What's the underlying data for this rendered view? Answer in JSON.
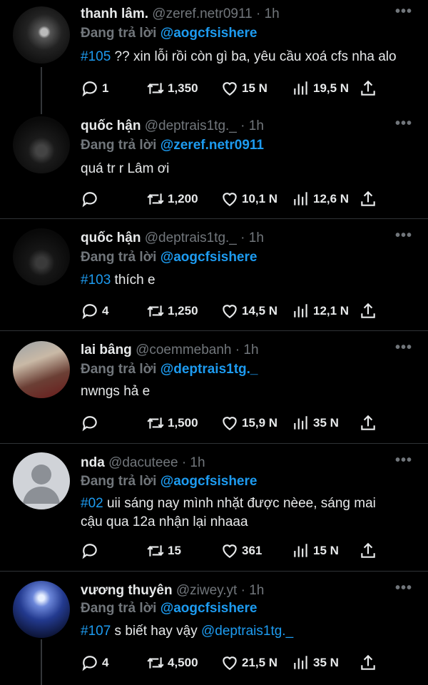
{
  "reply_prefix": "Đang trả lời",
  "colors": {
    "background": "#000000",
    "accent": "#1d9bf0",
    "muted": "#71767b",
    "text": "#e7e9ea"
  },
  "icons": [
    "reply-icon",
    "retweet-icon",
    "like-icon",
    "views-icon",
    "share-icon",
    "more-icon"
  ],
  "tweets": [
    {
      "name": "thanh lâm.",
      "handle": "@zeref.netr0911",
      "time": "· 1h",
      "reply_to": "@aogcfsishere",
      "tag": "#105",
      "text": " ?? xin lỗi rồi còn gì ba, yêu cầu xoá cfs nha alo",
      "replies": "1",
      "retweets": "1,350",
      "likes": "15 N",
      "views": "19,5 N"
    },
    {
      "name": "quốc hận",
      "handle": "@deptrais1tg._",
      "time": "· 1h",
      "reply_to": "@zeref.netr0911",
      "tag": "",
      "text": "quá tr r Lâm ơi",
      "replies": "",
      "retweets": "1,200",
      "likes": "10,1 N",
      "views": "12,6 N"
    },
    {
      "name": "quốc hận",
      "handle": "@deptrais1tg._",
      "time": "· 1h",
      "reply_to": "@aogcfsishere",
      "tag": "#103",
      "text": " thích e",
      "replies": "4",
      "retweets": "1,250",
      "likes": "14,5 N",
      "views": "12,1 N"
    },
    {
      "name": "lai bâng",
      "handle": "@coemmebanh",
      "time": "· 1h",
      "reply_to": "@deptrais1tg._",
      "tag": "",
      "text": "nwngs hả e",
      "replies": "",
      "retweets": "1,500",
      "likes": "15,9 N",
      "views": "35 N"
    },
    {
      "name": "nda",
      "handle": "@dacuteee",
      "time": "· 1h",
      "reply_to": "@aogcfsishere",
      "tag": "#02",
      "text": " uii sáng nay mình nhặt được nèee, sáng mai cậu qua 12a nhận lại nhaaa",
      "replies": "",
      "retweets": "15",
      "likes": "361",
      "views": "15 N"
    },
    {
      "name": "vương thuyên",
      "handle": "@ziwey.yt",
      "time": "· 1h",
      "reply_to": "@aogcfsishere",
      "tag": "#107",
      "text": " s biết hay vậy ",
      "text_mention": "@deptrais1tg._",
      "replies": "4",
      "retweets": "4,500",
      "likes": "21,5 N",
      "views": "35 N"
    }
  ]
}
